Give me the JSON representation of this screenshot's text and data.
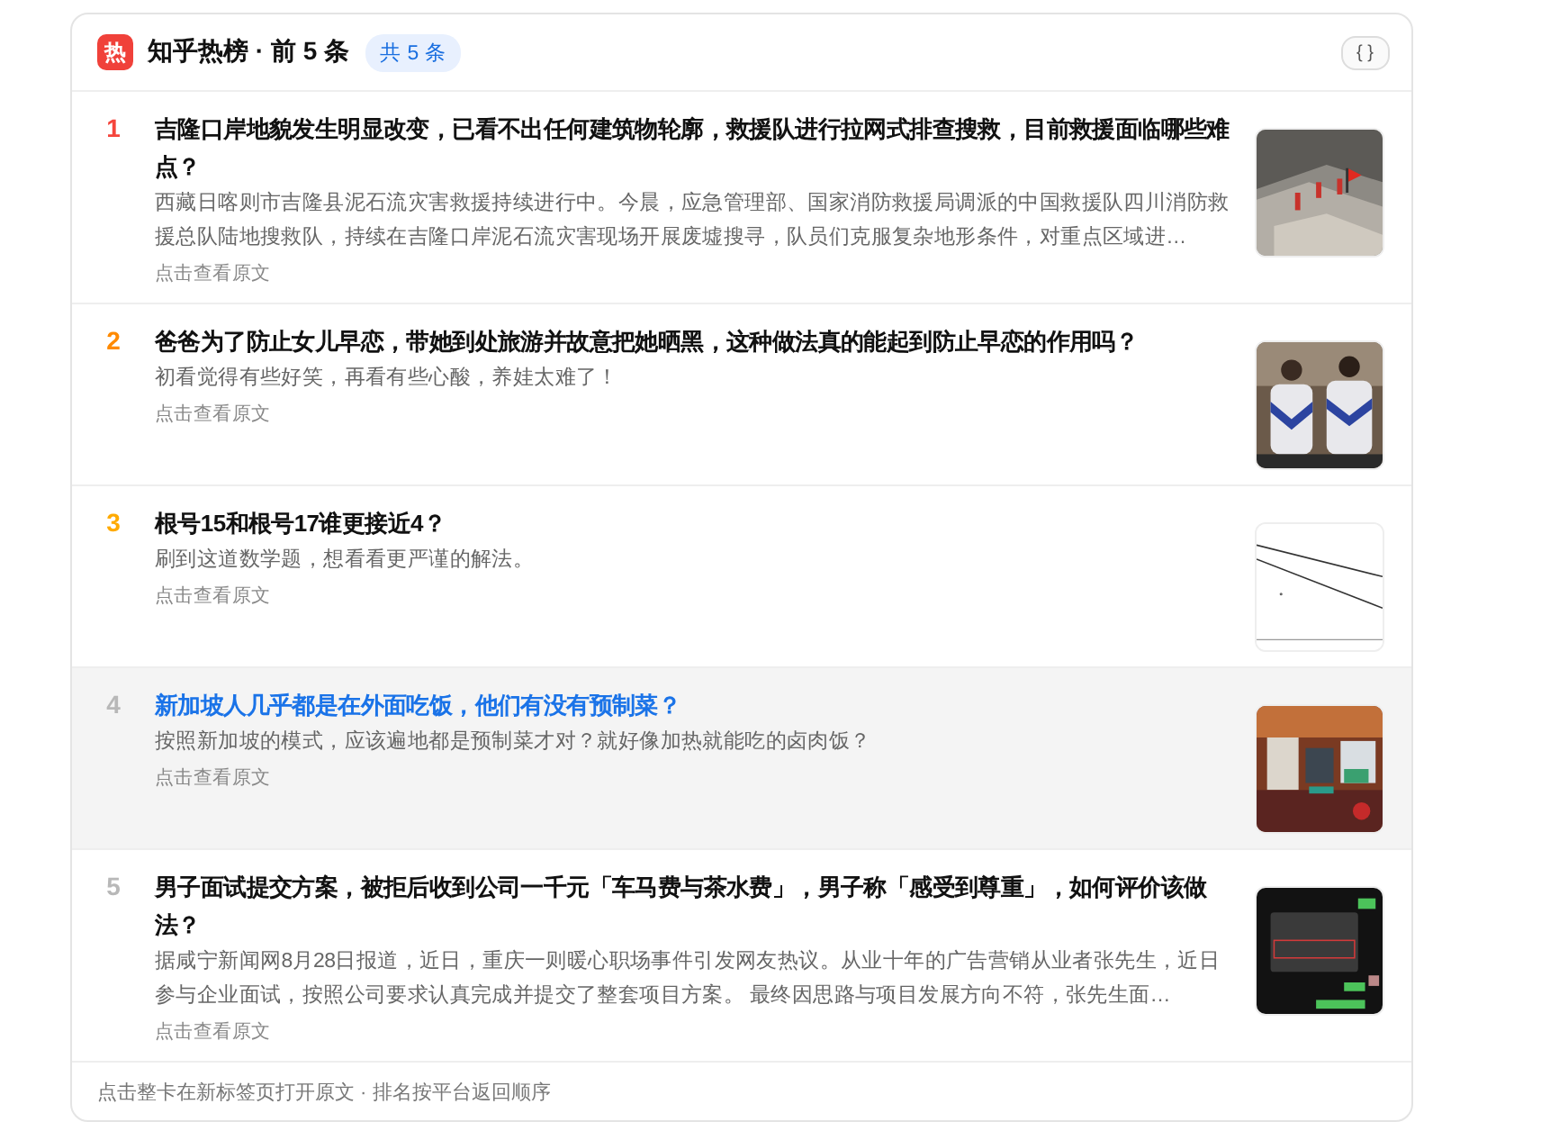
{
  "header": {
    "icon_text": "热",
    "title": "知乎热榜 · 前 5 条",
    "badge": "共 5 条",
    "button": "{ }"
  },
  "items": [
    {
      "rank": "1",
      "color": "#f5453c",
      "hovered": false,
      "title": "吉隆口岸地貌发生明显改变，已看不出任何建筑物轮廓，救援队进行拉网式排查搜救，目前救援面临哪些难点？",
      "excerpt": "西藏日喀则市吉隆县泥石流灾害救援持续进行中。今晨，应急管理部、国家消防救援局调派的中国救援队四川消防救援总队陆地搜救队，持续在吉隆口岸泥石流灾害现场开展废墟搜寻，队员们克服复杂地形条件，对重点区域进…",
      "link": "点击查看原文"
    },
    {
      "rank": "2",
      "color": "#ff8a00",
      "hovered": false,
      "title": "爸爸为了防止女儿早恋，带她到处旅游并故意把她晒黑，这种做法真的能起到防止早恋的作用吗？",
      "excerpt": "初看觉得有些好笑，再看有些心酸，养娃太难了！",
      "link": "点击查看原文"
    },
    {
      "rank": "3",
      "color": "#ffaa00",
      "hovered": false,
      "title": "根号15和根号17谁更接近4？",
      "excerpt": "刷到这道数学题，想看看更严谨的解法。",
      "link": "点击查看原文"
    },
    {
      "rank": "4",
      "color": "#b8b8b8",
      "hovered": true,
      "title": "新加坡人几乎都是在外面吃饭，他们有没有预制菜？",
      "excerpt": "按照新加坡的模式，应该遍地都是预制菜才对？就好像加热就能吃的卤肉饭？",
      "link": "点击查看原文"
    },
    {
      "rank": "5",
      "color": "#b8b8b8",
      "hovered": false,
      "title": "男子面试提交方案，被拒后收到公司一千元「车马费与茶水费」，男子称「感受到尊重」，如何评价该做法？",
      "excerpt": "据咸宁新闻网8月28日报道，近日，重庆一则暖心职场事件引发网友热议。从业十年的广告营销从业者张先生，近日参与企业面试，按照公司要求认真完成并提交了整套项目方案。 最终因思路与项目发展方向不符，张先生面…",
      "link": "点击查看原文"
    }
  ],
  "footer": "点击整卡在新标签页打开原文 · 排名按平台返回顺序"
}
